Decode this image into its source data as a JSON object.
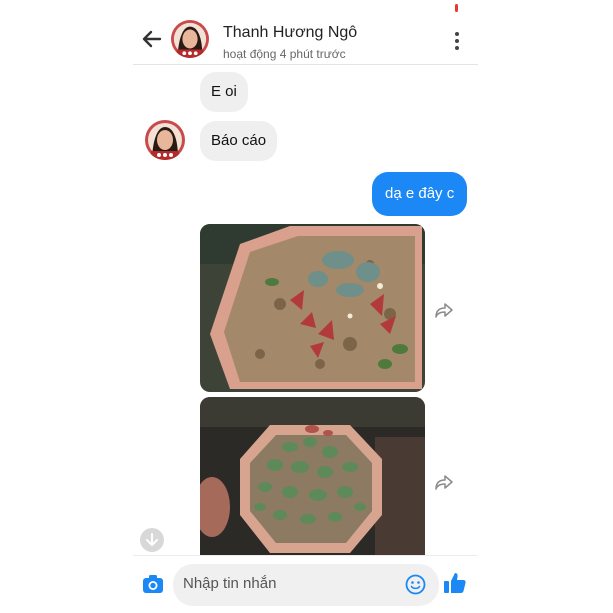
{
  "header": {
    "contact_name": "Thanh Hương Ngô",
    "status": "hoạt động 4 phút trước",
    "back_icon": "arrow-left-icon",
    "menu_icon": "more-vertical-icon"
  },
  "messages": [
    {
      "from": "them",
      "text": "E oi"
    },
    {
      "from": "them",
      "text": "Báo cáo"
    },
    {
      "from": "me",
      "text": "dạ e đây c"
    },
    {
      "from": "me",
      "type": "photo",
      "subject": "potted-plant-1"
    },
    {
      "from": "me",
      "type": "photo",
      "subject": "potted-plant-2"
    }
  ],
  "composer": {
    "placeholder": "Nhập tin nhắn",
    "camera_icon": "camera-icon",
    "emoji_icon": "smile-icon",
    "like_icon": "thumbs-up-icon"
  },
  "colors": {
    "accent": "#1b88f5",
    "incoming_bubble": "#efefef"
  }
}
